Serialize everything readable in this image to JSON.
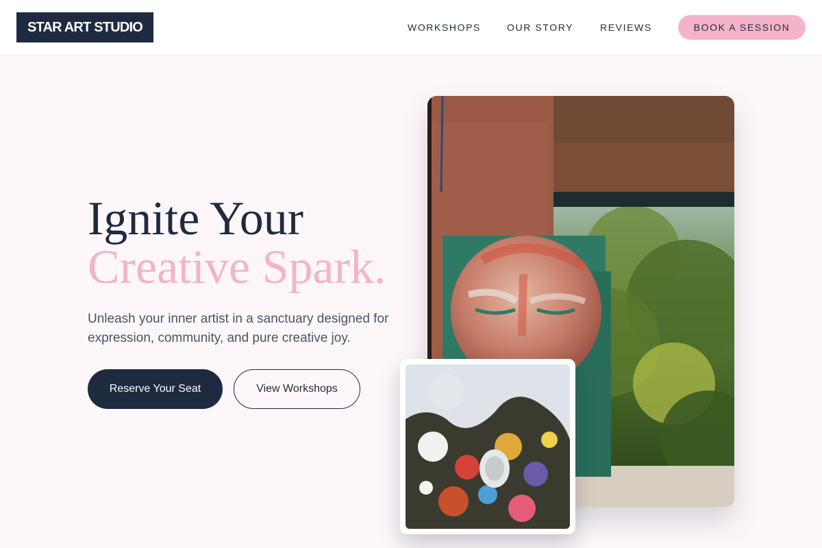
{
  "header": {
    "logo": "STAR ART STUDIO",
    "nav": {
      "workshops": "WORKSHOPS",
      "story": "OUR STORY",
      "reviews": "REVIEWS"
    },
    "cta": "BOOK A SESSION"
  },
  "hero": {
    "headline_line1": "Ignite Your",
    "headline_line2": "Creative Spark.",
    "subtitle": "Unleash your inner artist in a sanctuary designed for expression, community, and pure creative joy.",
    "primary_button": "Reserve Your Seat",
    "secondary_button": "View Workshops"
  },
  "colors": {
    "navy": "#1e2a40",
    "pink": "#f5b3c8",
    "background": "#fdf7f9",
    "text_muted": "#4a5468"
  }
}
